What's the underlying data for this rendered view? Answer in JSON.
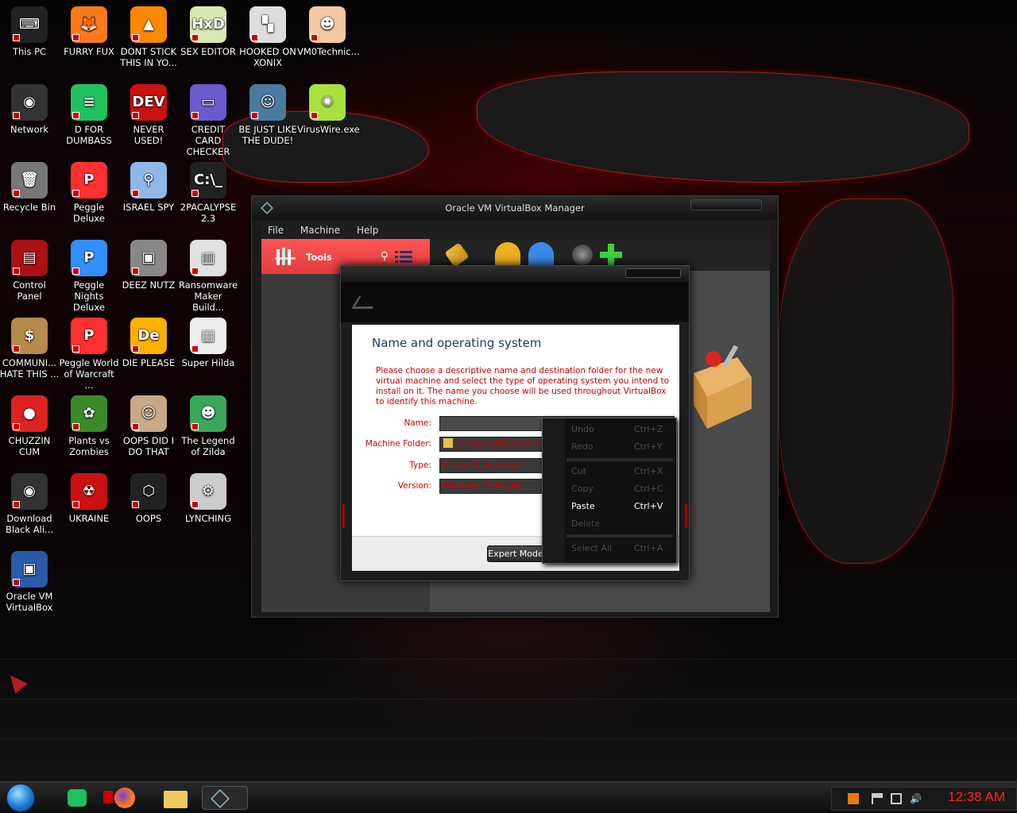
{
  "desktop_icons": [
    {
      "label": "This PC",
      "color": "#222222",
      "glyph": "⌨"
    },
    {
      "label": "FURRY FUX",
      "color": "#ff7a1a",
      "glyph": "🦊"
    },
    {
      "label": "DONT STICK THIS IN YO...",
      "color": "#ff8800",
      "glyph": "▲"
    },
    {
      "label": "SEX EDITOR",
      "color": "#d9e8b0",
      "glyph": "HxD"
    },
    {
      "label": "HOOKED ON XONIX",
      "color": "#dddddd",
      "glyph": "▚"
    },
    {
      "label": "VM0Technic...",
      "color": "#f2c9a0",
      "glyph": "☻"
    },
    {
      "label": "Network",
      "color": "#333333",
      "glyph": "◉"
    },
    {
      "label": "D FOR DUMBASS",
      "color": "#20c060",
      "glyph": "≡"
    },
    {
      "label": "NEVER USED!",
      "color": "#cc1111",
      "glyph": "DEV"
    },
    {
      "label": "CREDIT CARD CHECKER",
      "color": "#6a5acd",
      "glyph": "▭"
    },
    {
      "label": "BE JUST LIKE THE DUDE!",
      "color": "#4a7aa0",
      "glyph": "☺"
    },
    {
      "label": "VirusWire.exe",
      "color": "#a8e040",
      "glyph": "✺"
    },
    {
      "label": "Recycle Bin",
      "color": "#777777",
      "glyph": "🗑"
    },
    {
      "label": "Peggle Deluxe",
      "color": "#ff3030",
      "glyph": "P"
    },
    {
      "label": "ISRAEL SPY",
      "color": "#8fb8e8",
      "glyph": "⚲"
    },
    {
      "label": "2PACALYPSE 2.3",
      "color": "#222222",
      "glyph": "C:\\_"
    },
    {
      "label": "Control Panel",
      "color": "#aa1111",
      "glyph": "▤"
    },
    {
      "label": "Peggle Nights Deluxe",
      "color": "#3090ff",
      "glyph": "P"
    },
    {
      "label": "DEEZ NUTZ",
      "color": "#888888",
      "glyph": "▣"
    },
    {
      "label": "Ransomware Maker Build...",
      "color": "#e0e0e0",
      "glyph": "▥"
    },
    {
      "label": "COMMUNI... HATE THIS ...",
      "color": "#b58a4a",
      "glyph": "$"
    },
    {
      "label": "Peggle World of Warcraft ...",
      "color": "#ff3030",
      "glyph": "P"
    },
    {
      "label": "DIE PLEASE",
      "color": "#ffb000",
      "glyph": "De"
    },
    {
      "label": "Super Hilda",
      "color": "#eeeeee",
      "glyph": "▦"
    },
    {
      "label": "CHUZZIN CUM",
      "color": "#dd2222",
      "glyph": "●"
    },
    {
      "label": "Plants vs Zombies",
      "color": "#3a8a2a",
      "glyph": "✿"
    },
    {
      "label": "OOPS DID I DO THAT",
      "color": "#c8a888",
      "glyph": "☺"
    },
    {
      "label": "The Legend of Zilda",
      "color": "#3aa85a",
      "glyph": "☻"
    },
    {
      "label": "Download Black Ali...",
      "color": "#333333",
      "glyph": "◉"
    },
    {
      "label": "UKRAINE",
      "color": "#cc1111",
      "glyph": "☢"
    },
    {
      "label": "OOPS",
      "color": "#222222",
      "glyph": "⬡"
    },
    {
      "label": "LYNCHING",
      "color": "#cccccc",
      "glyph": "⚙"
    },
    {
      "label": "Oracle VM VirtualBox",
      "color": "#2a5aa8",
      "glyph": "▣"
    }
  ],
  "vbox": {
    "title": "Oracle VM VirtualBox Manager",
    "menu": [
      "File",
      "Machine",
      "Help"
    ],
    "tools_label": "Tools"
  },
  "wizard": {
    "page_title": "Name and operating system",
    "description": "Please choose a descriptive name and destination folder for the new virtual machine and select the type of operating system you intend to install on it. The name you choose will be used throughout VirtualBox to identify this machine.",
    "name_label": "Name:",
    "name_value": "",
    "folder_label": "Machine Folder:",
    "folder_value": "C:\\Users\\Whites\\VirtualBox VMs",
    "type_label": "Type:",
    "type_value": "Microsoft Windows",
    "version_label": "Version:",
    "version_value": "Windows 7 (64-bit)",
    "expert_button": "Expert Mode"
  },
  "context_menu": [
    {
      "label": "Undo",
      "shortcut": "Ctrl+Z",
      "enabled": false
    },
    {
      "label": "Redo",
      "shortcut": "Ctrl+Y",
      "enabled": false
    },
    {
      "label": "Cut",
      "shortcut": "Ctrl+X",
      "enabled": false
    },
    {
      "label": "Copy",
      "shortcut": "Ctrl+C",
      "enabled": false
    },
    {
      "label": "Paste",
      "shortcut": "Ctrl+V",
      "enabled": true
    },
    {
      "label": "Delete",
      "shortcut": "",
      "enabled": false
    },
    {
      "label": "Select All",
      "shortcut": "Ctrl+A",
      "enabled": false
    }
  ],
  "taskbar": {
    "clock": "12:38 AM"
  },
  "colors": {
    "accent_red": "#ff2222",
    "tools_red": "#e33c3c",
    "dialog_title_blue": "#1d3a6e"
  }
}
